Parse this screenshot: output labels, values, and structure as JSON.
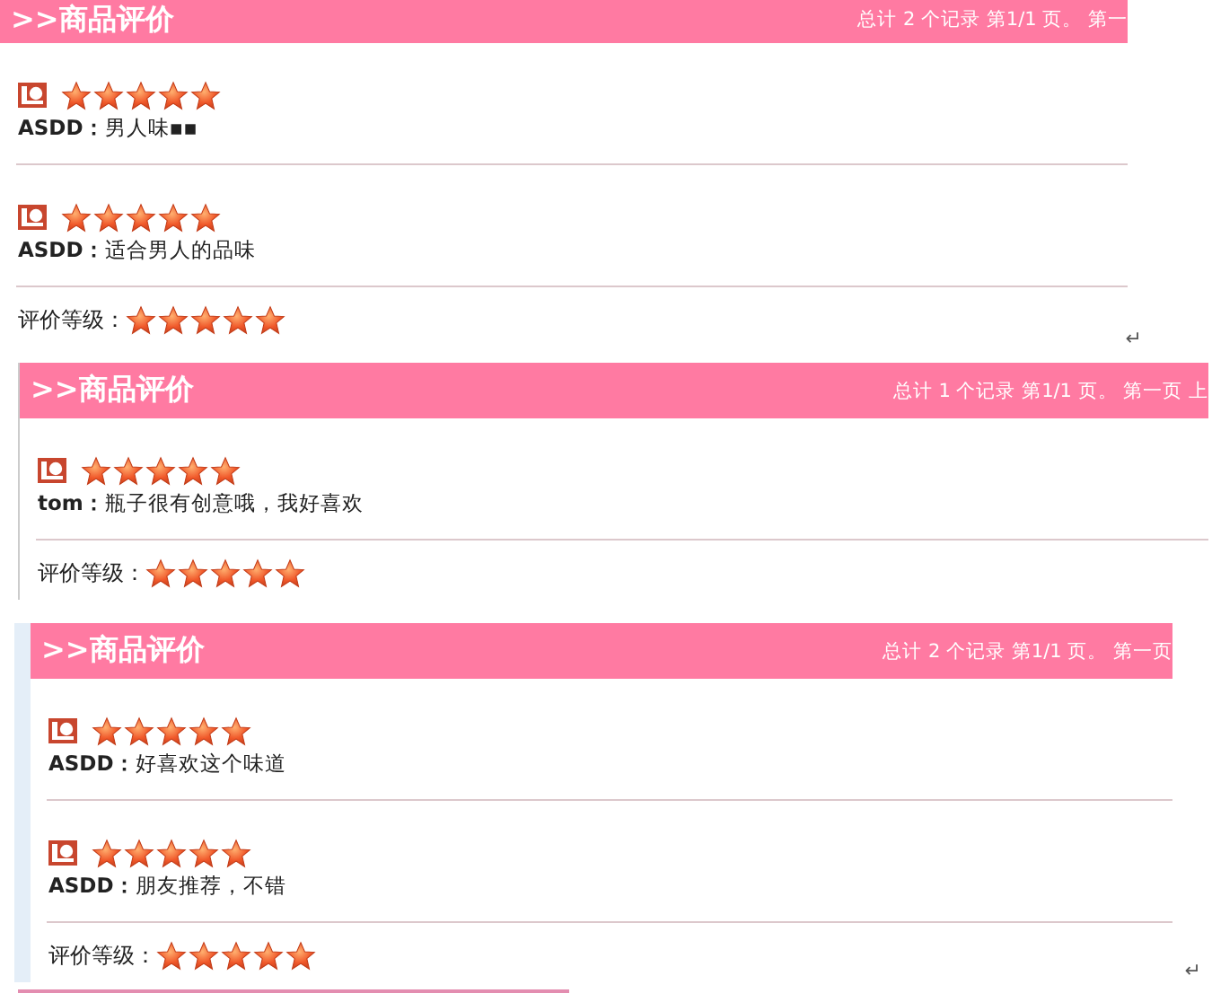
{
  "panels": [
    {
      "title": ">>商品评价",
      "pager": "总计 2 个记录 第1/1 页。 第一",
      "reviews": [
        {
          "text": "**ASDD：**男人味▪▪",
          "stars": 5
        },
        {
          "text": "**ASDD：**适合男人的品味",
          "stars": 5
        }
      ],
      "rating": {
        "label": "评价等级：",
        "stars": 5
      },
      "return_mark": "↵"
    },
    {
      "title": ">>商品评价",
      "pager": "总计 1 个记录 第1/1 页。 第一页 上",
      "reviews": [
        {
          "text": "**tom：**瓶子很有创意哦，我好喜欢",
          "stars": 5
        }
      ],
      "rating": {
        "label": "评价等级：",
        "stars": 5
      }
    },
    {
      "title": ">>商品评价",
      "pager": "总计 2 个记录 第1/1 页。 第一页",
      "reviews": [
        {
          "text": "**ASDD：**好喜欢这个味道",
          "stars": 5
        },
        {
          "text": "**ASDD：**朋友推荐，不错",
          "stars": 5
        }
      ],
      "rating": {
        "label": "评价等级：",
        "stars": 5
      },
      "return_mark": "↵"
    }
  ]
}
